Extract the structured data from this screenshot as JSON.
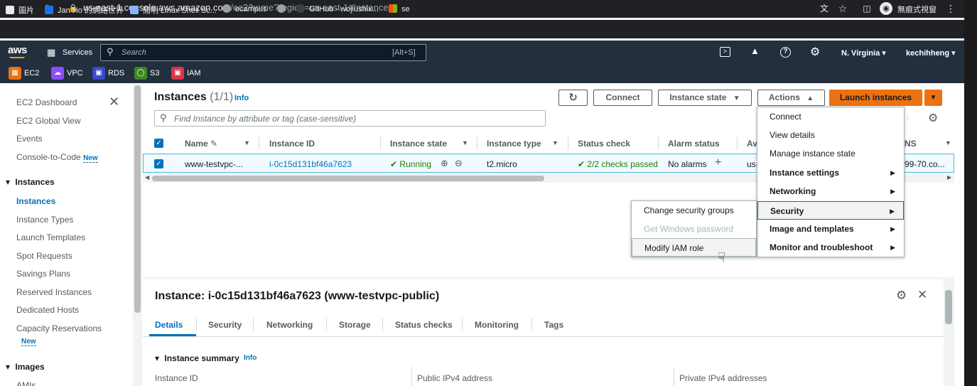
{
  "browser": {
    "url_host": "us-east-1.console.aws.amazon.com",
    "url_rest": "/ec2/home?region=us-east-1#Instances:",
    "profile_label": "無痕式視窗",
    "bookmarks": [
      {
        "label": "圖片",
        "color": "#e8eaed"
      },
      {
        "label": "Jan Ho 的網絡世界",
        "color": "#1a73e8"
      },
      {
        "label": "簡明 Linux Shell Sc...",
        "color": "#8ab4f8"
      },
      {
        "label": "ecampus",
        "color": "#9aa0a6"
      },
      {
        "label": "",
        "color": "#9aa0a6"
      },
      {
        "label": "GitHub - wojiushix...",
        "color": "#202124"
      },
      {
        "label": "se",
        "color": "#f4b400"
      }
    ]
  },
  "aws_nav": {
    "logo": "aws",
    "services_label": "Services",
    "search_placeholder": "Search",
    "search_shortcut": "[Alt+S]",
    "region": "N. Virginia",
    "user": "kechihheng",
    "favorites": [
      {
        "label": "EC2",
        "color": "#ec7211"
      },
      {
        "label": "VPC",
        "color": "#8c4fff"
      },
      {
        "label": "RDS",
        "color": "#3b48cc"
      },
      {
        "label": "S3",
        "color": "#3f8624"
      },
      {
        "label": "IAM",
        "color": "#dd344c"
      }
    ]
  },
  "sidebar": {
    "items_top": [
      "EC2 Dashboard",
      "EC2 Global View",
      "Events",
      "Console-to-Code"
    ],
    "new_label": "New",
    "section_instances": "Instances",
    "instances_items": [
      "Instances",
      "Instance Types",
      "Launch Templates",
      "Spot Requests",
      "Savings Plans",
      "Reserved Instances",
      "Dedicated Hosts",
      "Capacity Reservations"
    ],
    "section_images": "Images",
    "images_items": [
      "AMIs"
    ]
  },
  "instances": {
    "title": "Instances",
    "count": "(1/1)",
    "info": "Info",
    "buttons": {
      "connect": "Connect",
      "instance_state": "Instance state",
      "actions": "Actions",
      "launch": "Launch instances"
    },
    "search_placeholder": "Find Instance by attribute or tag (case-sensitive)",
    "columns": [
      "Name",
      "Instance ID",
      "Instance state",
      "Instance type",
      "Status check",
      "Alarm status",
      "Av",
      "NS"
    ],
    "row": {
      "name": "www-testvpc-...",
      "instance_id": "i-0c15d131bf46a7623",
      "state": "Running",
      "type": "t2.micro",
      "status_check": "2/2 checks passed",
      "alarm_status": "No alarms",
      "az": "us-",
      "dns": "99-70.co..."
    }
  },
  "actions_menu": {
    "items": [
      "Connect",
      "View details",
      "Manage instance state",
      "Instance settings",
      "Networking",
      "Security",
      "Image and templates",
      "Monitor and troubleshoot"
    ]
  },
  "security_submenu": {
    "items": [
      "Change security groups",
      "Get Windows password",
      "Modify IAM role"
    ]
  },
  "details": {
    "title": "Instance: i-0c15d131bf46a7623 (www-testvpc-public)",
    "tabs": [
      "Details",
      "Security",
      "Networking",
      "Storage",
      "Status checks",
      "Monitoring",
      "Tags"
    ],
    "summary_title": "Instance summary",
    "info": "Info",
    "fields": [
      "Instance ID",
      "Public IPv4 address",
      "Private IPv4 addresses"
    ]
  }
}
